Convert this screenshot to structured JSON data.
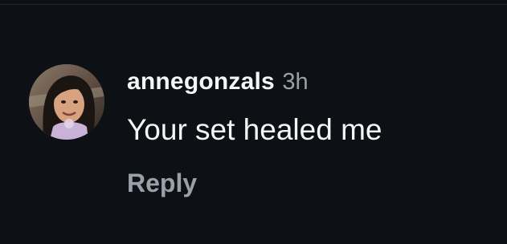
{
  "comment": {
    "username": "annegonzals",
    "timestamp": "3h",
    "text": "Your set healed me",
    "reply_label": "Reply"
  },
  "colors": {
    "background": "#0d1015",
    "primary_text": "#f5f5f5",
    "secondary_text": "#9aa0a8"
  }
}
